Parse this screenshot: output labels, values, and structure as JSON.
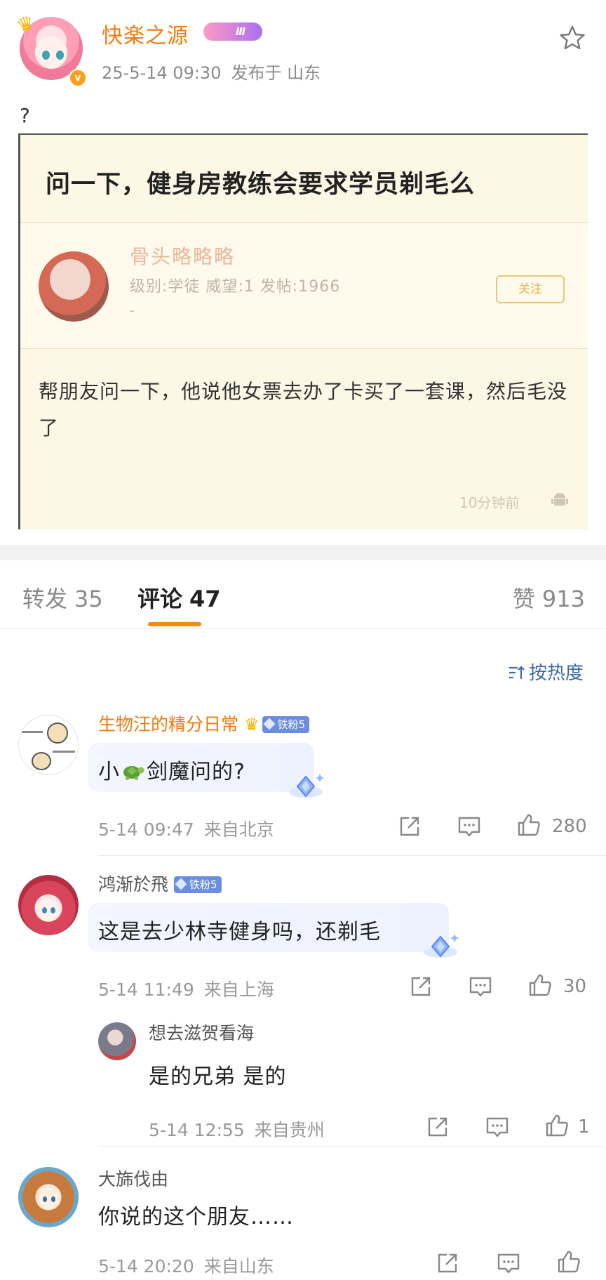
{
  "post": {
    "author": "快楽之源",
    "level_badge": "Ⅲ",
    "time": "25-5-14 09:30",
    "location": "发布于 山东",
    "text": "?"
  },
  "image": {
    "title": "问一下，健身房教练会要求学员剃毛么",
    "user": "骨头略略略",
    "stats": "级别:学徒 威望:1 发帖:1966",
    "dash": "-",
    "follow": "关注",
    "body": "帮朋友问一下，他说他女票去办了卡买了一套课，然后毛没了",
    "time": "10分钟前"
  },
  "tabs": {
    "repost_label": "转发",
    "repost_count": "35",
    "comments_label": "评论",
    "comments_count": "47",
    "likes_label": "赞",
    "likes_count": "913"
  },
  "sort": {
    "label": "按热度"
  },
  "comments": [
    {
      "name": "生物汪的精分日常",
      "badge": "铁粉5",
      "text_a": "小",
      "text_b": "剑魔问的?",
      "time": "5-14 09:47",
      "location": "来自北京",
      "likes": "280"
    },
    {
      "name": "鸿渐於飛",
      "badge": "铁粉5",
      "text": "这是去少林寺健身吗，还剃毛",
      "time": "5-14 11:49",
      "location": "来自上海",
      "likes": "30"
    },
    {
      "name": "想去滋贺看海",
      "text": "是的兄弟 是的",
      "time": "5-14 12:55",
      "location": "来自贵州",
      "likes": "1"
    },
    {
      "name": "大旆伐由",
      "text": "你说的这个朋友……",
      "time": "5-14 20:20",
      "location": "来自山东",
      "likes": ""
    }
  ],
  "colors": {
    "accent_orange": "#f07b10",
    "link_blue": "#3d6aa8",
    "fan_badge": "#6b8de0"
  },
  "icons": [
    "star-icon",
    "verified-icon",
    "crown-icon",
    "sort-icon",
    "share-icon",
    "comment-icon",
    "like-icon",
    "turtle-emoji-icon",
    "android-icon",
    "sparkle-gem-icon"
  ]
}
